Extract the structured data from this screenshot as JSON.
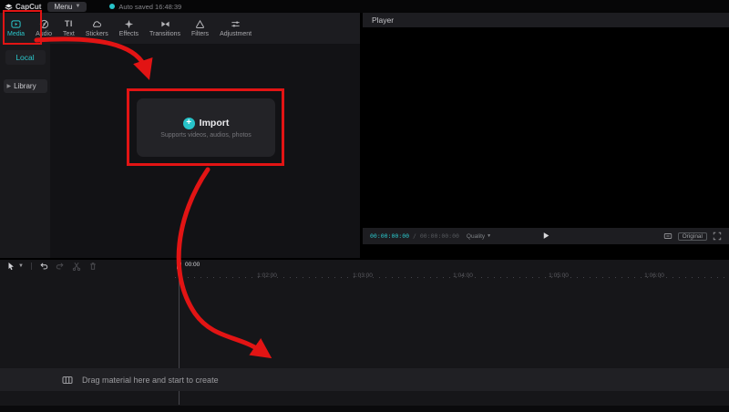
{
  "topbar": {
    "app_name": "CapCut",
    "menu_label": "Menu",
    "autosave_text": "Auto saved 16:48:39"
  },
  "ribbon": {
    "tabs": [
      {
        "label": "Media",
        "active": true
      },
      {
        "label": "Audio",
        "active": false
      },
      {
        "label": "Text",
        "active": false
      },
      {
        "label": "Stickers",
        "active": false
      },
      {
        "label": "Effects",
        "active": false
      },
      {
        "label": "Transitions",
        "active": false
      },
      {
        "label": "Filters",
        "active": false
      },
      {
        "label": "Adjustment",
        "active": false
      }
    ]
  },
  "sidebar": {
    "local_label": "Local",
    "library_label": "Library"
  },
  "import_panel": {
    "button_label": "Import",
    "hint_text": "Supports videos, audios, photos"
  },
  "player": {
    "title": "Player",
    "current_time": "00:00:00:00",
    "duration": "/ 00:00:00:00",
    "quality_label": "Quality",
    "original_label": "Original"
  },
  "timeline": {
    "playhead_time": "00:00",
    "ruler_labels": [
      "1:02:00",
      "1:03:00",
      "1:04:00",
      "1:05:00",
      "1:06:00"
    ],
    "drag_hint": "Drag material here and start to create"
  },
  "colors": {
    "accent_teal": "#2bc7cb",
    "annotation_red": "#e21414"
  }
}
